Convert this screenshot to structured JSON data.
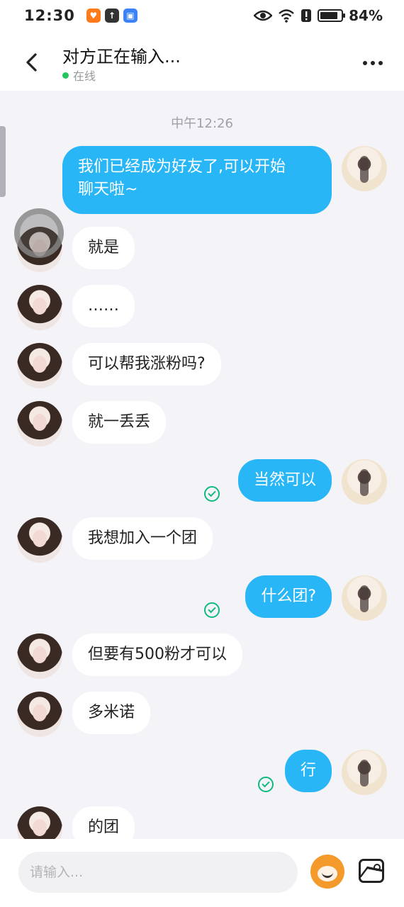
{
  "status_bar": {
    "time": "12:30",
    "apps": [
      {
        "icon": "taobao-icon",
        "color": "#ff7a1a",
        "glyph": "♥"
      },
      {
        "icon": "upload-icon",
        "color": "#333333",
        "glyph": "↑"
      },
      {
        "icon": "shield-icon",
        "color": "#3b82f6",
        "glyph": "▣"
      }
    ],
    "battery_percent": "84%",
    "battery_level": 0.84
  },
  "header": {
    "title": "对方正在输入...",
    "presence": "在线"
  },
  "messages": {
    "time_divider": "中午12:26",
    "items": [
      {
        "from": "me",
        "text": "我们已经成为好友了,可以开始\n聊天啦~"
      },
      {
        "from": "peer",
        "text": "就是"
      },
      {
        "from": "peer",
        "text": "……"
      },
      {
        "from": "peer",
        "text": "可以帮我涨粉吗?"
      },
      {
        "from": "peer",
        "text": "就一丢丢"
      },
      {
        "from": "me",
        "text": "当然可以",
        "read": true
      },
      {
        "from": "peer",
        "text": "我想加入一个团"
      },
      {
        "from": "me",
        "text": "什么团?",
        "read": true
      },
      {
        "from": "peer",
        "text": "但要有500粉才可以"
      },
      {
        "from": "peer",
        "text": "多米诺"
      },
      {
        "from": "me",
        "text": "行",
        "read": true
      },
      {
        "from": "peer",
        "text": "的团"
      }
    ]
  },
  "input_bar": {
    "placeholder": "请输入..."
  },
  "colors": {
    "accent": "#29b6f6",
    "read_check": "#10b981",
    "online": "#22c55e"
  }
}
